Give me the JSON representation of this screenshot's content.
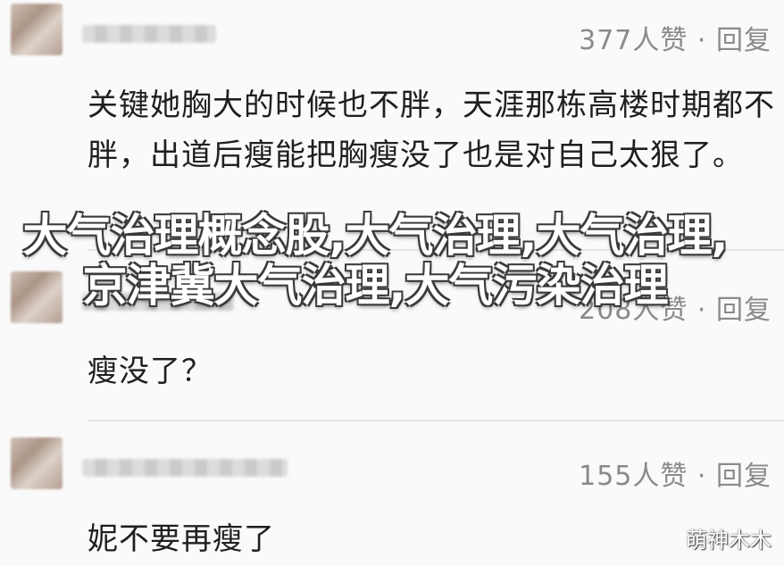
{
  "comments": [
    {
      "likes": "377人赞 · 回复",
      "text": "关键她胸大的时候也不胖，天涯那栋高楼时期都不胖，出道后瘦能把胸瘦没了也是对自己太狠了。"
    },
    {
      "likes": "208人赞 · 回复",
      "text": "瘦没了？"
    },
    {
      "likes": "155人赞 · 回复",
      "text": "妮不要再瘦了"
    }
  ],
  "overlay": {
    "title": "大气治理概念股,大气治理,大气治理,京津冀大气治理,大气污染治理"
  },
  "watermark": "萌神木木"
}
